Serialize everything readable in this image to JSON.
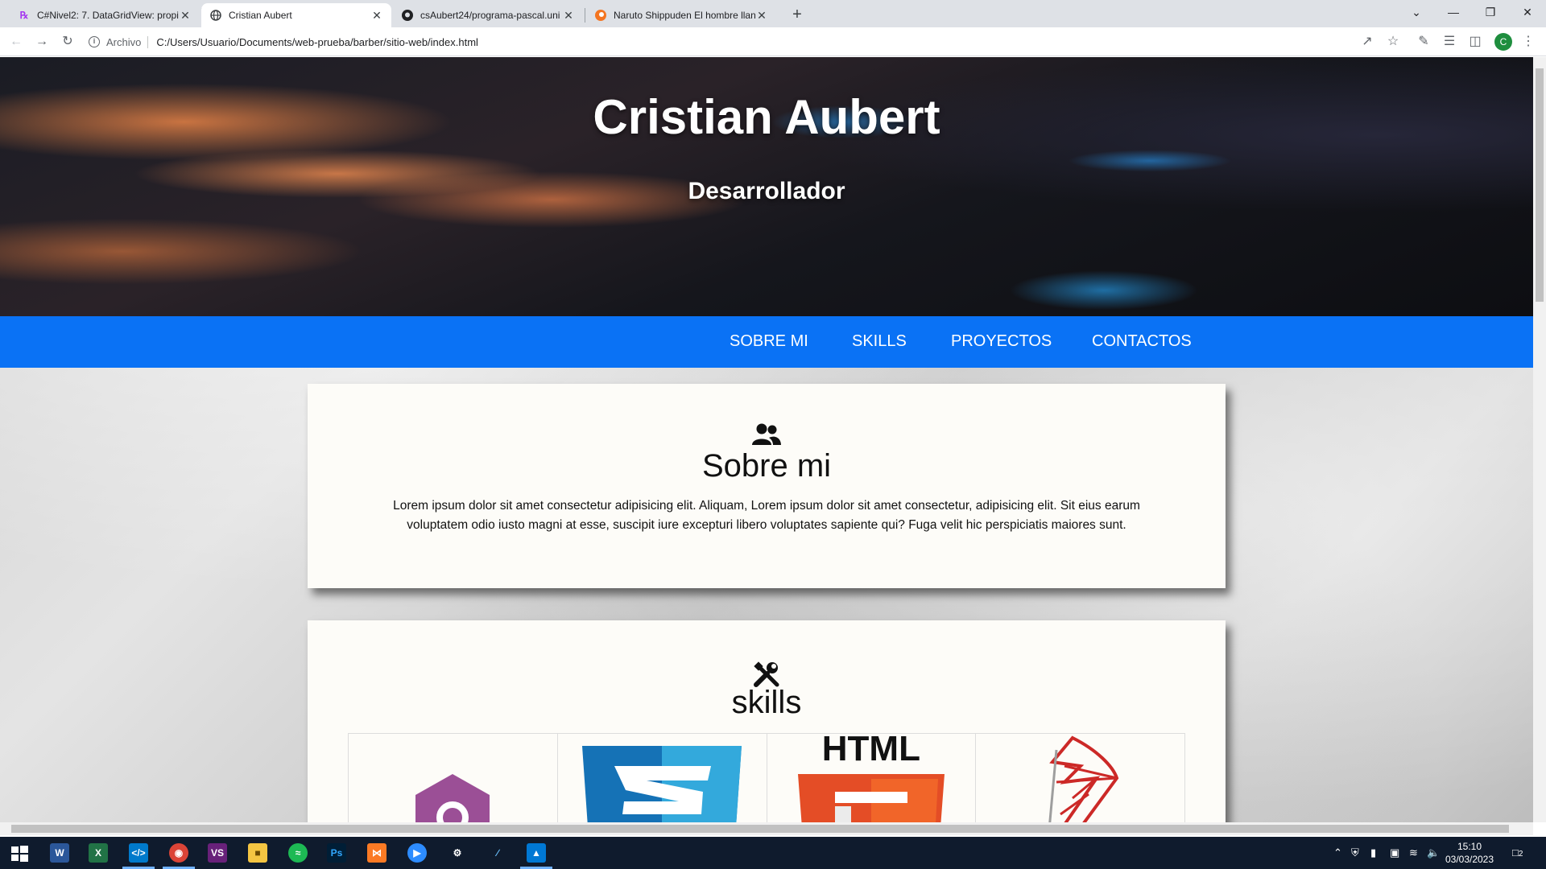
{
  "browser": {
    "tabs": [
      {
        "title": "C#Nivel2: 7. DataGridView: propi",
        "icon": "udemy-icon"
      },
      {
        "title": "Cristian Aubert",
        "icon": "globe-icon",
        "active": true
      },
      {
        "title": "csAubert24/programa-pascal.uni",
        "icon": "github-icon"
      },
      {
        "title": "Naruto Shippuden El hombre llan",
        "icon": "crunchyroll-icon"
      }
    ],
    "new_tab": "+",
    "address_scheme": "Archivo",
    "address_url": "C:/Users/Usuario/Documents/web-prueba/barber/sitio-web/index.html",
    "profile_initial": "C"
  },
  "page": {
    "hero_title": "Cristian Aubert",
    "hero_subtitle": "Desarrollador",
    "nav": [
      "SOBRE MI",
      "SKILLS",
      "PROYECTOS",
      "CONTACTOS"
    ],
    "about": {
      "icon": "users-icon",
      "title": "Sobre mi",
      "text": "Lorem ipsum dolor sit amet consectetur adipisicing elit. Aliquam, Lorem ipsum dolor sit amet consectetur, adipisicing elit. Sit eius earum voluptatem odio iusto magni at esse, suscipit iure excepturi libero voluptates sapiente qui? Fuga velit hic perspiciatis maiores sunt."
    },
    "skills": {
      "icon": "tools-icon",
      "title": "skills",
      "items": [
        {
          "name": "csharp-logo",
          "color": "#9b4f96"
        },
        {
          "name": "css3-logo",
          "color": "#1572b6"
        },
        {
          "name": "html5-logo",
          "label": "HTML",
          "color": "#e44d26"
        },
        {
          "name": "sql-server-logo",
          "color": "#cc2927"
        }
      ]
    }
  },
  "taskbar": {
    "apps": [
      "start-icon",
      "word-icon",
      "excel-icon",
      "vscode-icon",
      "chrome-icon",
      "visual-studio-icon",
      "file-explorer-icon",
      "spotify-icon",
      "photoshop-icon",
      "xampp-icon",
      "zoom-icon",
      "settings-icon",
      "azure-data-studio-icon",
      "photos-icon"
    ],
    "time": "15:10",
    "date": "03/03/2023",
    "notifications": "2"
  }
}
